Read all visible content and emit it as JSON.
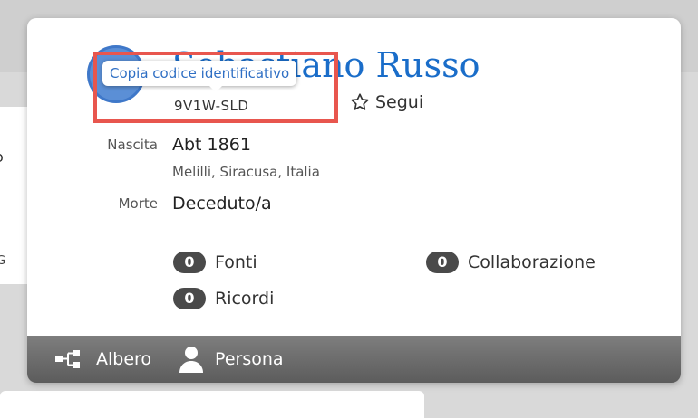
{
  "tooltip": {
    "text": "Copia codice identificativo"
  },
  "person": {
    "name": "Sebastiano Russo",
    "id": "9V1W-SLD",
    "follow_label": "Segui"
  },
  "birth": {
    "label": "Nascita",
    "date": "Abt 1861",
    "place": "Melilli, Siracusa, Italia"
  },
  "death": {
    "label": "Morte",
    "value": "Deceduto/a"
  },
  "stats": [
    {
      "count": "0",
      "label": "Fonti"
    },
    {
      "count": "0",
      "label": "Collaborazione"
    },
    {
      "count": "0",
      "label": "Ricordi"
    }
  ],
  "footer": {
    "tree_label": "Albero",
    "person_label": "Persona"
  },
  "background": {
    "left_text1": "o",
    "left_text2": "G",
    "left_chevron": "o"
  },
  "colors": {
    "name": "#1a6dc9",
    "highlight": "#e8564e",
    "footer": "#6b6b6b",
    "badge": "#4a4a4a"
  },
  "icons": {
    "follow": "star-outline-icon",
    "tree": "tree-icon",
    "person": "person-icon"
  }
}
